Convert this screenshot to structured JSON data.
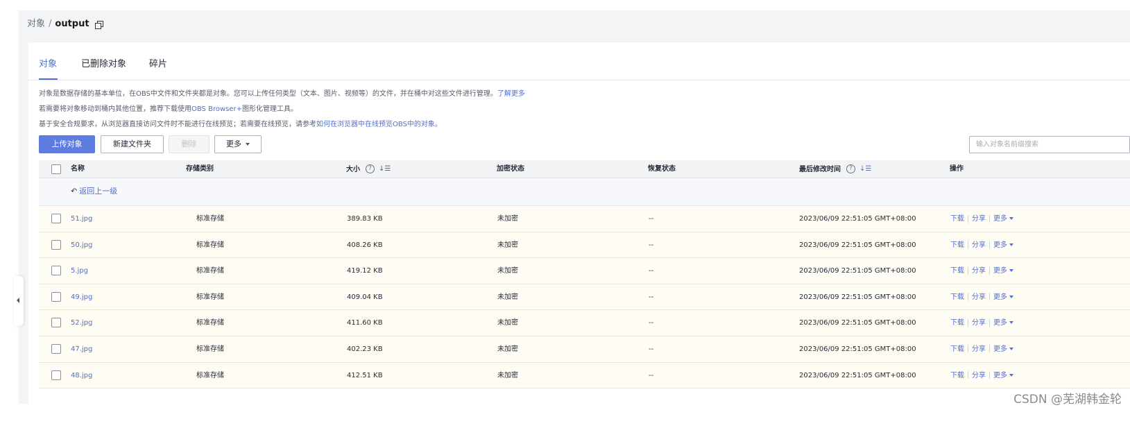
{
  "breadcrumb": {
    "root": "对象",
    "separator": "/",
    "current": "output",
    "copy_icon": "copy-icon"
  },
  "tabs": [
    {
      "label": "对象",
      "active": true
    },
    {
      "label": "已删除对象",
      "active": false
    },
    {
      "label": "碎片",
      "active": false
    }
  ],
  "info": {
    "line1_text": "对象是数据存储的基本单位，在OBS中文件和文件夹都是对象。您可以上传任何类型（文本、图片、视频等）的文件，并在桶中对这些文件进行管理。",
    "line1_link": "了解更多",
    "line2_prefix": "若需要将对象移动到桶内其他位置，推荐下载使用",
    "line2_link": "OBS Browser+",
    "line2_suffix": "图形化管理工具。",
    "line3_prefix": "基于安全合规要求，从浏览器直接访问文件时不能进行在线预览；若需要在线预览，请参考",
    "line3_link": "如何在浏览器中在线预览OBS中的对象。"
  },
  "toolbar": {
    "upload_label": "上传对象",
    "new_folder_label": "新建文件夹",
    "delete_label": "删除",
    "more_label": "更多",
    "search_placeholder": "输入对象名前缀搜索"
  },
  "table": {
    "headers": {
      "name": "名称",
      "storage_class": "存储类别",
      "size": "大小",
      "encryption": "加密状态",
      "restore": "恢复状态",
      "modified": "最后修改时间",
      "actions": "操作"
    },
    "back_label": "返回上一级",
    "rows": [
      {
        "name": "51.jpg",
        "storage_class": "标准存储",
        "size": "389.83 KB",
        "encryption": "未加密",
        "restore": "--",
        "modified": "2023/06/09 22:51:05 GMT+08:00"
      },
      {
        "name": "50.jpg",
        "storage_class": "标准存储",
        "size": "408.26 KB",
        "encryption": "未加密",
        "restore": "--",
        "modified": "2023/06/09 22:51:05 GMT+08:00"
      },
      {
        "name": "5.jpg",
        "storage_class": "标准存储",
        "size": "419.12 KB",
        "encryption": "未加密",
        "restore": "--",
        "modified": "2023/06/09 22:51:05 GMT+08:00"
      },
      {
        "name": "49.jpg",
        "storage_class": "标准存储",
        "size": "409.04 KB",
        "encryption": "未加密",
        "restore": "--",
        "modified": "2023/06/09 22:51:05 GMT+08:00"
      },
      {
        "name": "52.jpg",
        "storage_class": "标准存储",
        "size": "411.60 KB",
        "encryption": "未加密",
        "restore": "--",
        "modified": "2023/06/09 22:51:05 GMT+08:00"
      },
      {
        "name": "47.jpg",
        "storage_class": "标准存储",
        "size": "402.23 KB",
        "encryption": "未加密",
        "restore": "--",
        "modified": "2023/06/09 22:51:05 GMT+08:00"
      },
      {
        "name": "48.jpg",
        "storage_class": "标准存储",
        "size": "412.51 KB",
        "encryption": "未加密",
        "restore": "--",
        "modified": "2023/06/09 22:51:05 GMT+08:00"
      }
    ],
    "row_actions": {
      "download": "下载",
      "share": "分享",
      "more": "更多"
    }
  },
  "watermark": "CSDN @芜湖韩金轮",
  "colors": {
    "accent": "#526ecc",
    "primary_button": "#5e7ce0",
    "row_background": "#fffcf3",
    "header_background": "#f2f3f5"
  }
}
